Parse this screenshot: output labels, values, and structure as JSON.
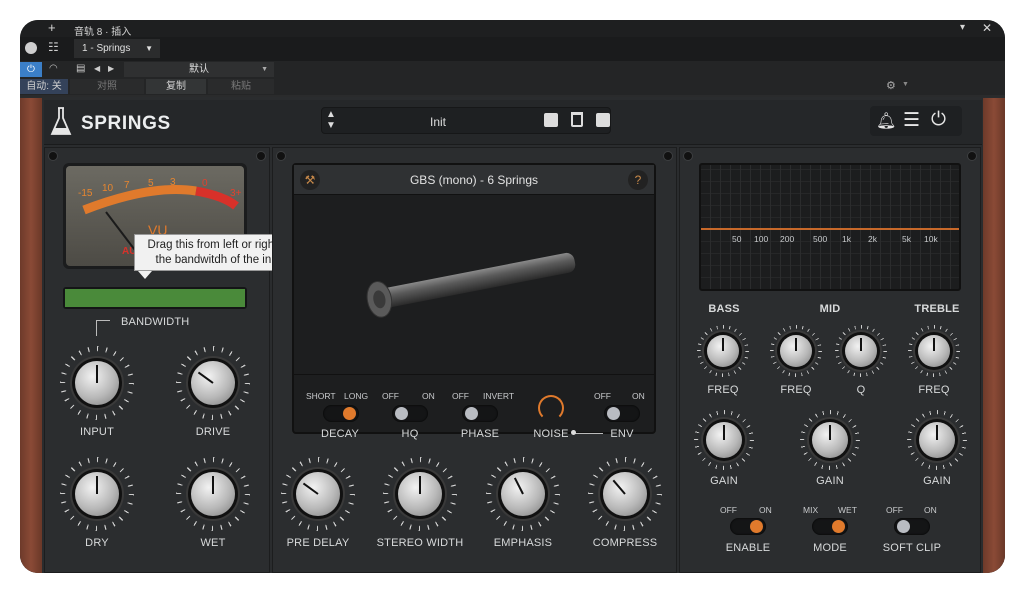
{
  "host": {
    "title": "音轨 8 · 插入",
    "track": "1 - Springs",
    "preset_default": "默认",
    "auto": "自动: 关",
    "compare": "对照",
    "copy": "复制",
    "paste": "粘贴"
  },
  "plugin": {
    "name": "SPRINGS",
    "preset": "Init",
    "spring_title": "GBS (mono) - 6 Springs",
    "help": "?",
    "tooltip_line1": "Drag this from left or right to reduce",
    "tooltip_line2": "the bandwitdh of the input signal",
    "vu": {
      "scale": [
        "-15",
        "10",
        "7",
        "5",
        "3",
        "0",
        "3+"
      ],
      "label": "VU",
      "brand": "AU"
    },
    "bandwidth_label": "BANDWIDTH",
    "left_knobs": [
      {
        "label": "INPUT",
        "value": 0.5
      },
      {
        "label": "DRIVE",
        "value": 0.3
      },
      {
        "label": "DRY",
        "value": 0.5
      },
      {
        "label": "WET",
        "value": 0.5
      }
    ],
    "switches": {
      "decay": {
        "off": "SHORT",
        "on": "LONG",
        "label": "DECAY",
        "state": "on"
      },
      "hq": {
        "off": "OFF",
        "on": "ON",
        "label": "HQ",
        "state": "off"
      },
      "phase": {
        "off": "OFF",
        "on": "INVERT",
        "label": "PHASE",
        "state": "off"
      },
      "noise": {
        "label": "NOISE"
      },
      "env": {
        "off": "OFF",
        "on": "ON",
        "label": "ENV",
        "state": "off"
      }
    },
    "mid_knobs": [
      {
        "label": "PRE DELAY",
        "value": 0.3
      },
      {
        "label": "STEREO WIDTH",
        "value": 0.5
      },
      {
        "label": "EMPHASIS",
        "value": 0.4
      },
      {
        "label": "COMPRESS",
        "value": 0.35
      }
    ],
    "eq": {
      "freq_labels": [
        "50",
        "100",
        "200",
        "500",
        "1k",
        "2k",
        "5k",
        "10k"
      ],
      "bass": "BASS",
      "mid": "MID",
      "treble": "TREBLE",
      "freq": "FREQ",
      "q": "Q",
      "gain": "GAIN"
    },
    "eq_switches": {
      "enable": {
        "off": "OFF",
        "on": "ON",
        "label": "ENABLE",
        "state": "on"
      },
      "mode": {
        "off": "MIX",
        "on": "WET",
        "label": "MODE",
        "state": "on"
      },
      "softclip": {
        "off": "OFF",
        "on": "ON",
        "label": "SOFT CLIP",
        "state": "off"
      }
    }
  },
  "colors": {
    "accent": "#e07a2c",
    "meter_green": "#4a8a3a",
    "vu_red": "#d8312a"
  }
}
